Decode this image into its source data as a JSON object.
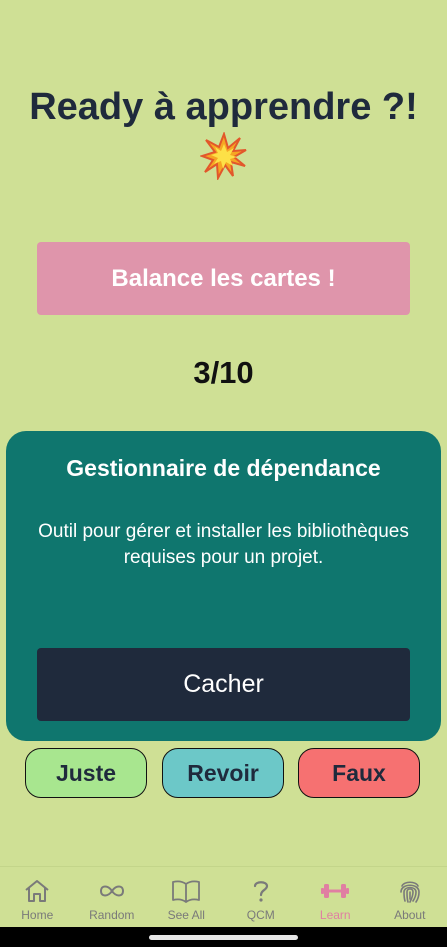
{
  "header": {
    "title": "Ready à apprendre ?!",
    "emoji": "💥"
  },
  "shuffle_button": {
    "label": "Balance les cartes !"
  },
  "progress": {
    "text": "3/10",
    "current": 3,
    "total": 10
  },
  "card": {
    "title": "Gestionnaire de dépendance",
    "definition": "Outil pour gérer et installer les bibliothèques requises pour un projet.",
    "hide_label": "Cacher"
  },
  "answers": {
    "correct_label": "Juste",
    "review_label": "Revoir",
    "wrong_label": "Faux"
  },
  "navbar": {
    "items": [
      {
        "label": "Home",
        "icon": "home-icon"
      },
      {
        "label": "Random",
        "icon": "infinity-icon"
      },
      {
        "label": "See All",
        "icon": "book-icon"
      },
      {
        "label": "QCM",
        "icon": "question-icon"
      },
      {
        "label": "Learn",
        "icon": "dumbbell-icon"
      },
      {
        "label": "About",
        "icon": "fingerprint-icon"
      }
    ],
    "active": "Learn"
  },
  "colors": {
    "background": "#cfe095",
    "accent_pink": "#df95ab",
    "card_teal": "#0f766e",
    "dark_navy": "#1f2a3c",
    "correct_green": "#a8e68f",
    "review_teal": "#6cc8c8",
    "wrong_red": "#f67171"
  }
}
